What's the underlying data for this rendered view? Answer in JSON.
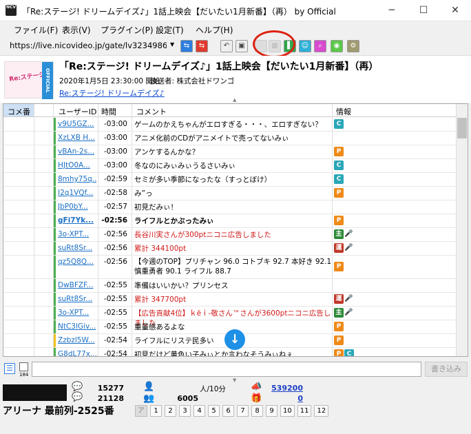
{
  "window": {
    "app_icon_text": "NCV",
    "title": "「Re:ステージ! ドリームデイズ♪」1話上映会【だいたい1月新番】（再） by Official"
  },
  "menu": [
    "ファイル(F)",
    "表示(V)",
    "プラグイン(P)",
    "設定(T)",
    "ヘルプ(H)"
  ],
  "toolbar": {
    "url": "https://live.nicovideo.jp/gate/lv323498618"
  },
  "program": {
    "thumb_label": "OFFICIAL",
    "title": "「Re:ステージ! ドリームデイズ♪」1話上映会【だいたい1月新番】（再）",
    "date": "2020年1月5日 23:30:00 開始",
    "caster": "放送者: 株式会社ドワンゴ",
    "link": "Re:ステージ! ドリームデイズ♪"
  },
  "table": {
    "headers": [
      "コメ番",
      "ユーザーID",
      "時間",
      "コメント",
      "情報"
    ],
    "rows": [
      {
        "uid": "v9U5GZ...",
        "time": "-03:00",
        "msg": "ゲームのかえちゃんがエロすぎる・・・、エロすぎない？",
        "bar": "#4caf50",
        "badges": [
          "C"
        ]
      },
      {
        "uid": "XzLXB H...",
        "time": "-03:00",
        "msg": "アニメ化前のCDがアニメイトで売ってないみぃ",
        "bar": "#4caf50",
        "badges": []
      },
      {
        "uid": "vBAn-2s...",
        "time": "-03:00",
        "msg": "アンケするんかな？",
        "bar": "#4caf50",
        "badges": [
          "P"
        ]
      },
      {
        "uid": "HJtO0A...",
        "time": "-03:00",
        "msg": "冬なのにみぃみぃうるさいみぃ",
        "bar": "#4caf50",
        "badges": [
          "C"
        ]
      },
      {
        "uid": "8mhy75q...",
        "time": "-02:59",
        "msg": "セミが多い季節になったな（すっとぼけ）",
        "bar": "#4caf50",
        "badges": [
          "C"
        ]
      },
      {
        "uid": "I2q1VQf...",
        "time": "-02:58",
        "msg": "み”っ",
        "bar": "#4caf50",
        "badges": [
          "P"
        ]
      },
      {
        "uid": "JbP0bY...",
        "time": "-02:57",
        "msg": "初見だみぃ！",
        "bar": "#4caf50",
        "badges": []
      },
      {
        "uid": "gFi7Yk...",
        "time": "-02:56",
        "msg": "ライフルとかぶったみぃ",
        "bar": "#4caf50",
        "badges": [
          "P"
        ],
        "bold": true
      },
      {
        "uid": "3o-XPT...",
        "time": "-02:56",
        "msg": "長谷川実さんが300ptニコニ広告しました",
        "bar": "#4caf50",
        "badges": [
          "主",
          "mic"
        ],
        "red": true
      },
      {
        "uid": "suRt8Sr...",
        "time": "-02:56",
        "msg": "累計 344100pt",
        "bar": "#4caf50",
        "badges": [
          "運",
          "mic"
        ],
        "red": true
      },
      {
        "uid": "qz5Q8Q...",
        "time": "-02:56",
        "msg": "【今週のTOP】プリチャン 96.0 コトブキ 92.7 本好き 92.1 慎重勇者 90.1 ライフル 88.7",
        "bar": "#4caf50",
        "badges": [
          "P"
        ]
      },
      {
        "uid": "DwBFZF...",
        "time": "-02:55",
        "msg": "準備はいいかい？プリンセス",
        "bar": "#4caf50",
        "badges": []
      },
      {
        "uid": "suRt8Sr...",
        "time": "-02:55",
        "msg": "累計 347700pt",
        "bar": "#4caf50",
        "badges": [
          "運",
          "mic"
        ],
        "red": true
      },
      {
        "uid": "3o-XPT...",
        "time": "-02:55",
        "msg": "【広告貢献4位】ｋëｉ-敬さん™さんが3600ptニコニ広告しました",
        "bar": "#4caf50",
        "badges": [
          "主",
          "mic"
        ],
        "red": true
      },
      {
        "uid": "NtC3lGiv...",
        "time": "-02:55",
        "msg": "重量感あるよな",
        "bar": "#4caf50",
        "badges": [
          "P"
        ]
      },
      {
        "uid": "Zzbzl5W...",
        "time": "-02:54",
        "msg": "ライフルにリステ民多い",
        "bar": "#f0c020",
        "badges": [
          "P"
        ]
      },
      {
        "uid": "G8dL77x...",
        "time": "-02:54",
        "msg": "初見だけど黄色い子みぃとか言わなそうみぃねぇ",
        "bar": "#4caf50",
        "badges": [
          "P",
          "C"
        ]
      }
    ]
  },
  "input": {
    "counter": "184",
    "post_label": "書き込み"
  },
  "stats": {
    "comments": "15277",
    "viewers_total": "21128",
    "per_10min": "人/10分",
    "per_10min_count": "6005",
    "ad_points": "539200",
    "gift_points": "0",
    "seat": "アリーナ 最前列-2525番",
    "blocks": [
      "ア",
      "1",
      "2",
      "3",
      "4",
      "5",
      "6",
      "7",
      "8",
      "9",
      "10",
      "11",
      "12"
    ]
  }
}
